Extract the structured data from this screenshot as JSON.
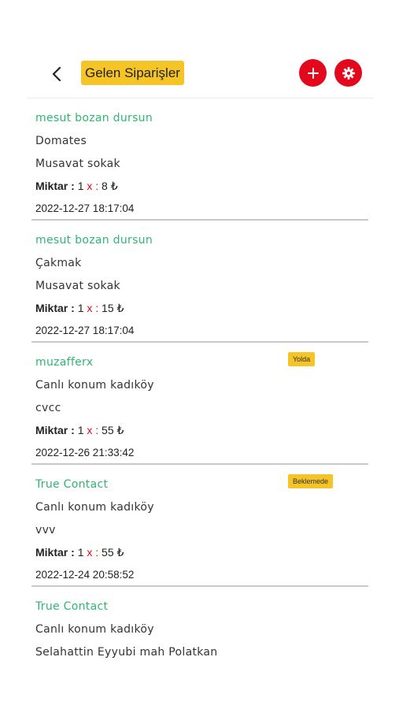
{
  "header": {
    "title": "Gelen Siparişler",
    "back_icon": "chevron-left-icon",
    "add_icon": "plus-icon",
    "settings_icon": "gear-icon",
    "button_color": "#e4081c",
    "title_bg": "#f5c427"
  },
  "labels": {
    "miktar": "Miktar :",
    "x": "x",
    "colon": ":",
    "currency": "₺"
  },
  "orders": [
    {
      "customer": "mesut bozan dursun",
      "product": "Domates",
      "address": "Musavat sokak",
      "qty": "1",
      "price": "8",
      "date": "2022-12-27 18:17:04"
    },
    {
      "customer": "mesut bozan dursun",
      "product": "Çakmak",
      "address": "Musavat sokak",
      "qty": "1",
      "price": "15",
      "date": "2022-12-27 18:17:04"
    },
    {
      "customer": "muzafferx",
      "product": "Canlı konum kadıköy",
      "address": "cvcc",
      "qty": "1",
      "price": "55",
      "date": "2022-12-26 21:33:42",
      "status": "Yolda"
    },
    {
      "customer": "True Contact",
      "product": "Canlı konum kadıköy",
      "address": "vvv",
      "qty": "1",
      "price": "55",
      "date": "2022-12-24 20:58:52",
      "status": "Beklemede"
    },
    {
      "customer": "True Contact",
      "product": "Canlı konum kadıköy",
      "address": "Selahattin Eyyubi mah Polatkan"
    }
  ]
}
